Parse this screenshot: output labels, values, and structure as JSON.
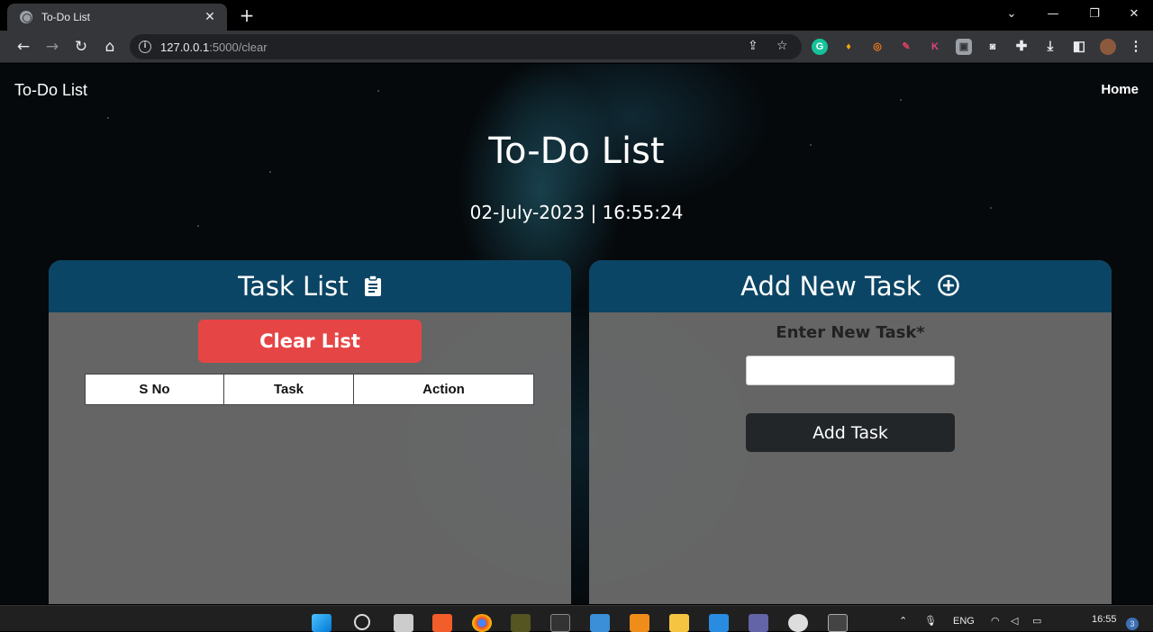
{
  "browser": {
    "tab_title": "To-Do List",
    "new_tab_symbol": "+",
    "url_host": "127.0.0.1",
    "url_rest": ":5000/clear"
  },
  "nav": {
    "brand": "To-Do List",
    "home_link": "Home"
  },
  "hero": {
    "title": "To-Do List",
    "datetime": "02-July-2023 | 16:55:24"
  },
  "task_list": {
    "header": "Task List",
    "clear_button": "Clear List",
    "columns": [
      "S No",
      "Task",
      "Action"
    ],
    "rows": []
  },
  "add_task": {
    "header": "Add New Task",
    "field_label": "Enter New Task*",
    "input_value": "",
    "submit_button": "Add Task"
  },
  "taskbar": {
    "lang": "ENG",
    "time": "16:55",
    "notifications": "3"
  },
  "colors": {
    "card_header": "#0b4565",
    "clear_button": "#e64545",
    "add_button": "#222629"
  }
}
